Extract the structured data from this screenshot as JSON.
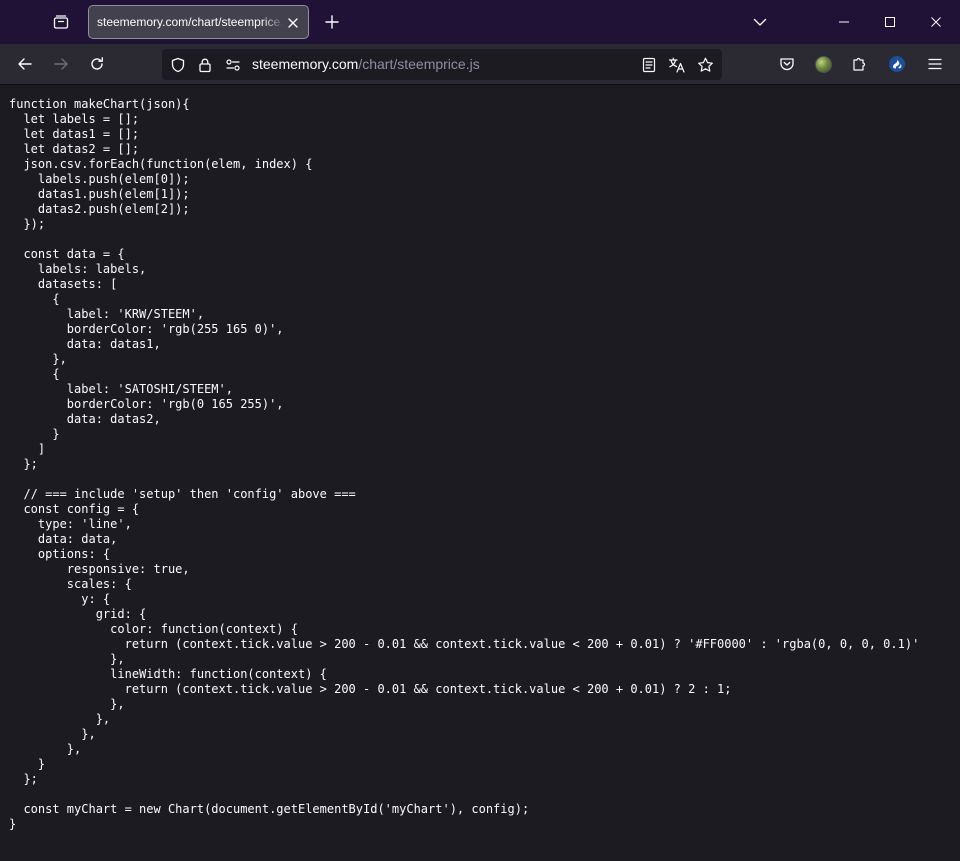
{
  "browser": {
    "tab": {
      "title": "steememory.com/chart/steemprice.js"
    },
    "url": {
      "domain": "steememory.com",
      "path": "/chart/steemprice.js"
    },
    "accent_color": "#1f1236"
  },
  "source_view": {
    "lines": [
      "function makeChart(json){",
      "  let labels = [];",
      "  let datas1 = [];",
      "  let datas2 = [];",
      "  json.csv.forEach(function(elem, index) {",
      "    labels.push(elem[0]);",
      "    datas1.push(elem[1]);",
      "    datas2.push(elem[2]);",
      "  });",
      "",
      "  const data = {",
      "    labels: labels,",
      "    datasets: [",
      "      {",
      "        label: 'KRW/STEEM',",
      "        borderColor: 'rgb(255 165 0)',",
      "        data: datas1,",
      "      },",
      "      {",
      "        label: 'SATOSHI/STEEM',",
      "        borderColor: 'rgb(0 165 255)',",
      "        data: datas2,",
      "      }",
      "    ]",
      "  };",
      "",
      "  // === include 'setup' then 'config' above ===",
      "  const config = {",
      "    type: 'line',",
      "    data: data,",
      "    options: {",
      "        responsive: true,",
      "        scales: {",
      "          y: {",
      "            grid: {",
      "              color: function(context) {",
      "                return (context.tick.value > 200 - 0.01 && context.tick.value < 200 + 0.01) ? '#FF0000' : 'rgba(0, 0, 0, 0.1)'",
      "              },",
      "              lineWidth: function(context) {",
      "                return (context.tick.value > 200 - 0.01 && context.tick.value < 200 + 0.01) ? 2 : 1;",
      "              },",
      "            },",
      "          },",
      "        },",
      "    }",
      "  };",
      "",
      "  const myChart = new Chart(document.getElementById('myChart'), config);",
      "}"
    ]
  }
}
